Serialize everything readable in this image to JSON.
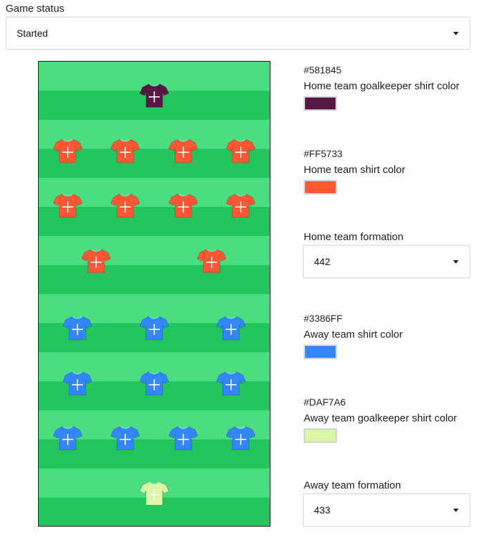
{
  "game_status": {
    "label": "Game status",
    "value": "Started"
  },
  "home_goalkeeper": {
    "hex": "#581845",
    "label": "Home team goalkeeper shirt color",
    "color": "#581845"
  },
  "home_shirt": {
    "hex": "#FF5733",
    "label": "Home team shirt color",
    "color": "#FF5733"
  },
  "home_formation": {
    "label": "Home team formation",
    "value": "442"
  },
  "away_shirt": {
    "hex": "#3386FF",
    "label": "Away team shirt color",
    "color": "#3386FF"
  },
  "away_goalkeeper": {
    "hex": "#DAF7A6",
    "label": "Away team goalkeeper shirt color",
    "color": "#DAF7A6"
  },
  "away_formation": {
    "label": "Away team formation",
    "value": "433"
  },
  "pitch": {
    "stripe_light": "#4ade80",
    "stripe_dark": "#22c55e"
  },
  "icons": {
    "shirt": "tshirt-icon",
    "dropdown": "caret-down-icon"
  }
}
